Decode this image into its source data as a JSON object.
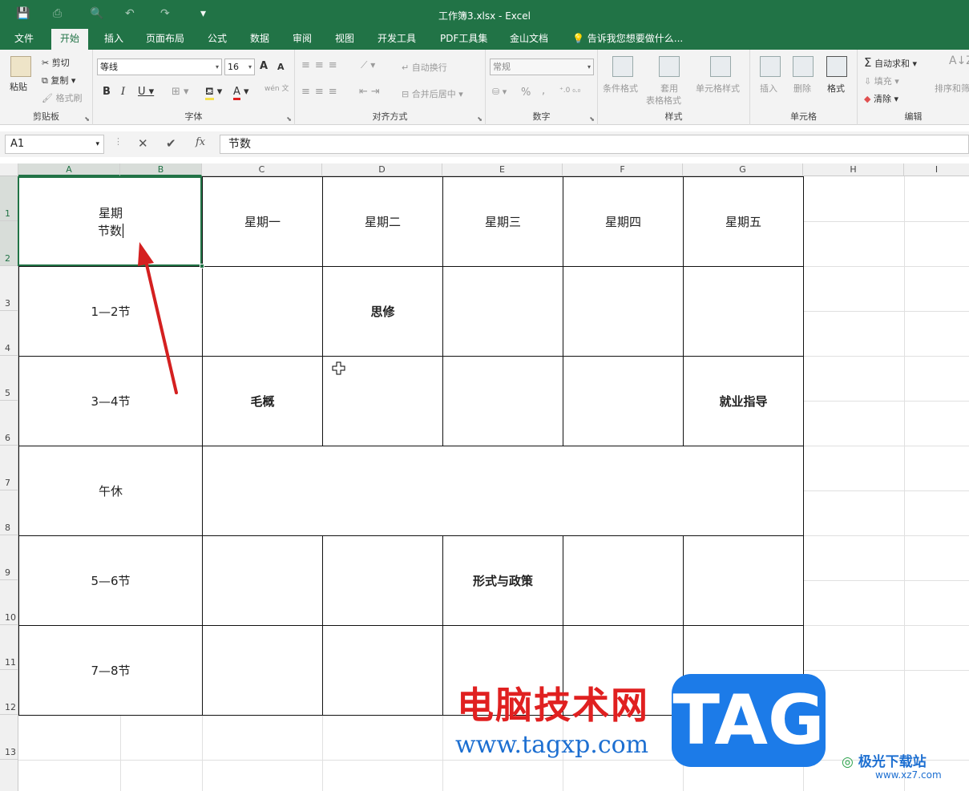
{
  "titlebar": {
    "title": "工作簿3.xlsx - Excel",
    "save_icon": "💾",
    "undo": "↶",
    "redo": "↷",
    "customize": "▾"
  },
  "tabs": [
    {
      "label": "文件"
    },
    {
      "label": "开始"
    },
    {
      "label": "插入"
    },
    {
      "label": "页面布局"
    },
    {
      "label": "公式"
    },
    {
      "label": "数据"
    },
    {
      "label": "审阅"
    },
    {
      "label": "视图"
    },
    {
      "label": "开发工具"
    },
    {
      "label": "PDF工具集"
    },
    {
      "label": "金山文档"
    }
  ],
  "tell_me": "告诉我您想要做什么...",
  "ribbon": {
    "clipboard": {
      "label": "剪贴板",
      "paste": "粘贴",
      "cut": "剪切",
      "copy": "复制",
      "format_painter": "格式刷"
    },
    "font": {
      "label": "字体",
      "font_name": "等线",
      "font_size": "16",
      "bold": "B",
      "italic": "I",
      "underline": "U",
      "grow": "A",
      "shrink": "A",
      "font_color": "A",
      "phonetic": "wén 文"
    },
    "alignment": {
      "label": "对齐方式",
      "wrap_text": "自动换行",
      "merge_center": "合并后居中"
    },
    "number": {
      "label": "数字",
      "format": "常规",
      "percent": "%",
      "comma": ","
    },
    "styles": {
      "label": "样式",
      "conditional": "条件格式",
      "table_format_1": "套用",
      "table_format_2": "表格格式",
      "cell_styles": "单元格样式"
    },
    "cells": {
      "label": "单元格",
      "insert": "插入",
      "delete": "删除",
      "format": "格式"
    },
    "editing": {
      "label": "编辑",
      "autosum": "自动求和",
      "fill": "填充",
      "clear": "清除",
      "sort": "排序和筛"
    }
  },
  "formula_bar": {
    "name_box": "A1",
    "cancel": "✕",
    "enter": "✔",
    "fx": "fx",
    "content": "节数"
  },
  "columns": [
    "A",
    "B",
    "C",
    "D",
    "E",
    "F",
    "G",
    "H",
    "I"
  ],
  "rows": [
    "1",
    "2",
    "3",
    "4",
    "5",
    "6",
    "7",
    "8",
    "9",
    "10",
    "11",
    "12",
    "13"
  ],
  "cells": {
    "a1_line1": "星期",
    "a1_line2": "节数",
    "mon": "星期一",
    "tue": "星期二",
    "wed": "星期三",
    "thu": "星期四",
    "fri": "星期五",
    "p12": "1—2节",
    "p34": "3—4节",
    "noon": "午休",
    "p56": "5—6节",
    "p78": "7—8节",
    "c_sixiu": "思修",
    "c_maogai": "毛概",
    "c_jiuye": "就业指导",
    "c_xingshi": "形式与政策"
  },
  "watermarks": {
    "site_name": "电脑技术网",
    "site_url": "www.tagxp.com",
    "tag": "TAG",
    "xz_name": "极光下载站",
    "xz_url": "www.xz7.com"
  },
  "colors": {
    "accent": "#217346",
    "arrow": "#d42020"
  }
}
